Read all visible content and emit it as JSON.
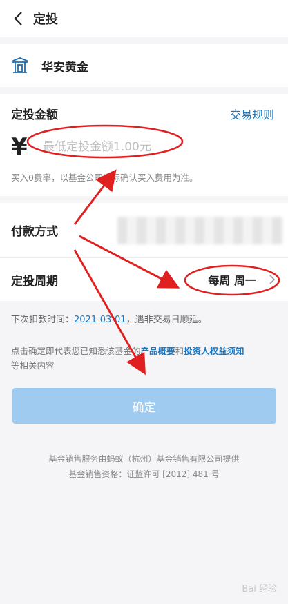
{
  "header": {
    "title": "定投"
  },
  "fund": {
    "name": "华安黄金"
  },
  "amount": {
    "title": "定投金额",
    "rules_link": "交易规则",
    "currency_symbol": "¥",
    "placeholder": "最低定投金额1.00元",
    "fee_note": "买入0费率，以基金公司实际确认买入费用为准。"
  },
  "payment": {
    "label": "付款方式"
  },
  "cycle": {
    "label": "定投周期",
    "value": "每周 周一"
  },
  "next_deduction": {
    "prefix": "下次扣款时间：",
    "date": "2021-03-01",
    "suffix": "，遇非交易日顺延。"
  },
  "agreement": {
    "prefix": "点击确定即代表您已知悉该基金的",
    "link1": "产品概要",
    "and": "和",
    "link2": "投资人权益须知",
    "suffix": "等相关内容"
  },
  "confirm_label": "确定",
  "footer": {
    "line1": "基金销售服务由蚂蚁（杭州）基金销售有限公司提供",
    "line2": "基金销售资格：证监许可 [2012] 481 号"
  },
  "watermark": "Bai 经验",
  "colors": {
    "accent": "#1a78c2",
    "annotation": "#e02020",
    "button": "#9ecbef"
  }
}
